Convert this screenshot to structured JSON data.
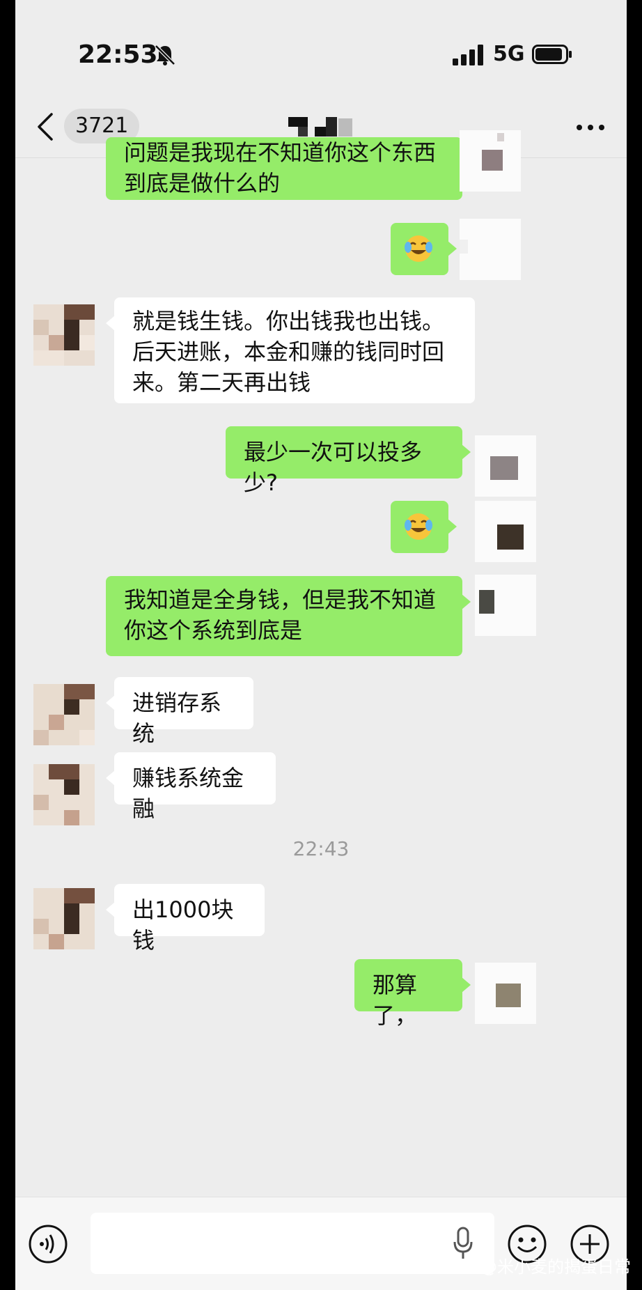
{
  "status_bar": {
    "time": "22:53",
    "network": "5G"
  },
  "nav": {
    "unread_count": "3721"
  },
  "messages": [
    {
      "from": "me",
      "text": "问题是我现在不知道你这个东西到底是做什么的"
    },
    {
      "from": "me",
      "emoji": "crying-laughing-emoji"
    },
    {
      "from": "other",
      "text": "就是钱生钱。你出钱我也出钱。后天进账，本金和赚的钱同时回来。第二天再出钱"
    },
    {
      "from": "me",
      "text": "最少一次可以投多少?"
    },
    {
      "from": "me",
      "emoji": "crying-laughing-emoji"
    },
    {
      "from": "me",
      "text": "我知道是全身钱，但是我不知道你这个系统到底是"
    },
    {
      "from": "other",
      "text": "进销存系统"
    },
    {
      "from": "other",
      "text": "赚钱系统金融"
    },
    {
      "timestamp": "22:43"
    },
    {
      "from": "other",
      "text": "出1000块钱"
    },
    {
      "from": "me",
      "text": "那算了，"
    }
  ],
  "watermark": "头条 @米小麦的揭蛋日常",
  "colors": {
    "my_bubble": "#95ec69",
    "other_bubble": "#ffffff",
    "background": "#ededed"
  }
}
